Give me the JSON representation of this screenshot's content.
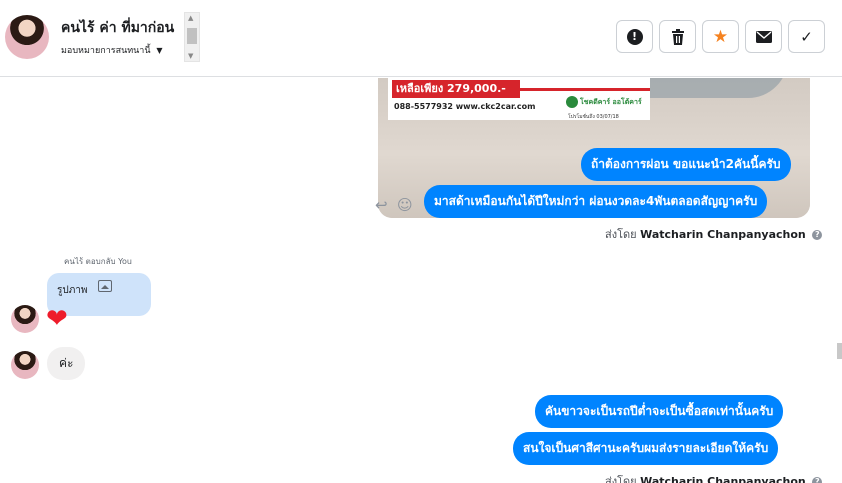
{
  "header": {
    "contact_name": "คนไร้ ค่า ที่มาก่อน",
    "assign_label": "มอบหมายการสนทนานี้",
    "scroll_up": "▲",
    "scroll_down": "▼",
    "toolbar": {
      "report_icon": "!",
      "delete_icon": "🗑",
      "star_icon": "★",
      "mail_icon": "✉",
      "done_icon": "✓"
    }
  },
  "messages": {
    "ad_image": {
      "price_text": "เหลือเพียง 279,000.-",
      "contact_line": "088-5577932 www.ckc2car.com",
      "brand_text": "โชคดีคาร์ ออโต้คาร์",
      "fine_print": "โปรโมชั่นถึง 03/07/18"
    },
    "outgoing_1": "ถ้าต้องการผ่อน ขอแนะนำ2คันนี้ครับ",
    "outgoing_2": "มาสด้าเหมือนกันได้ปีใหม่กว่า ผ่อนงวดละ4พันตลอดสัญญาครับ",
    "sent_by_prefix": "ส่งโดย",
    "sender_name": "Watcharin Chanpanyachon",
    "reply_context": "คนไร้ ตอบกลับ You",
    "reply_card_label": "รูปภาพ",
    "heart": "❤",
    "incoming_1": "ค่ะ",
    "outgoing_3": "คันขาวจะเป็นรถปีต่ำจะเป็นซื้อสดเท่านั้นครับ",
    "outgoing_4": "สนใจเป็นศาสีศานะครับผมส่งรายละเอียดให้ครับ",
    "reply_icon": "↩",
    "emoji_icon": "☺",
    "help_icon": "?"
  },
  "colors": {
    "outgoing_bubble": "#0084ff",
    "incoming_bubble": "#f1f0f0",
    "star": "#f58220",
    "reply_card": "#cfe3fa"
  }
}
